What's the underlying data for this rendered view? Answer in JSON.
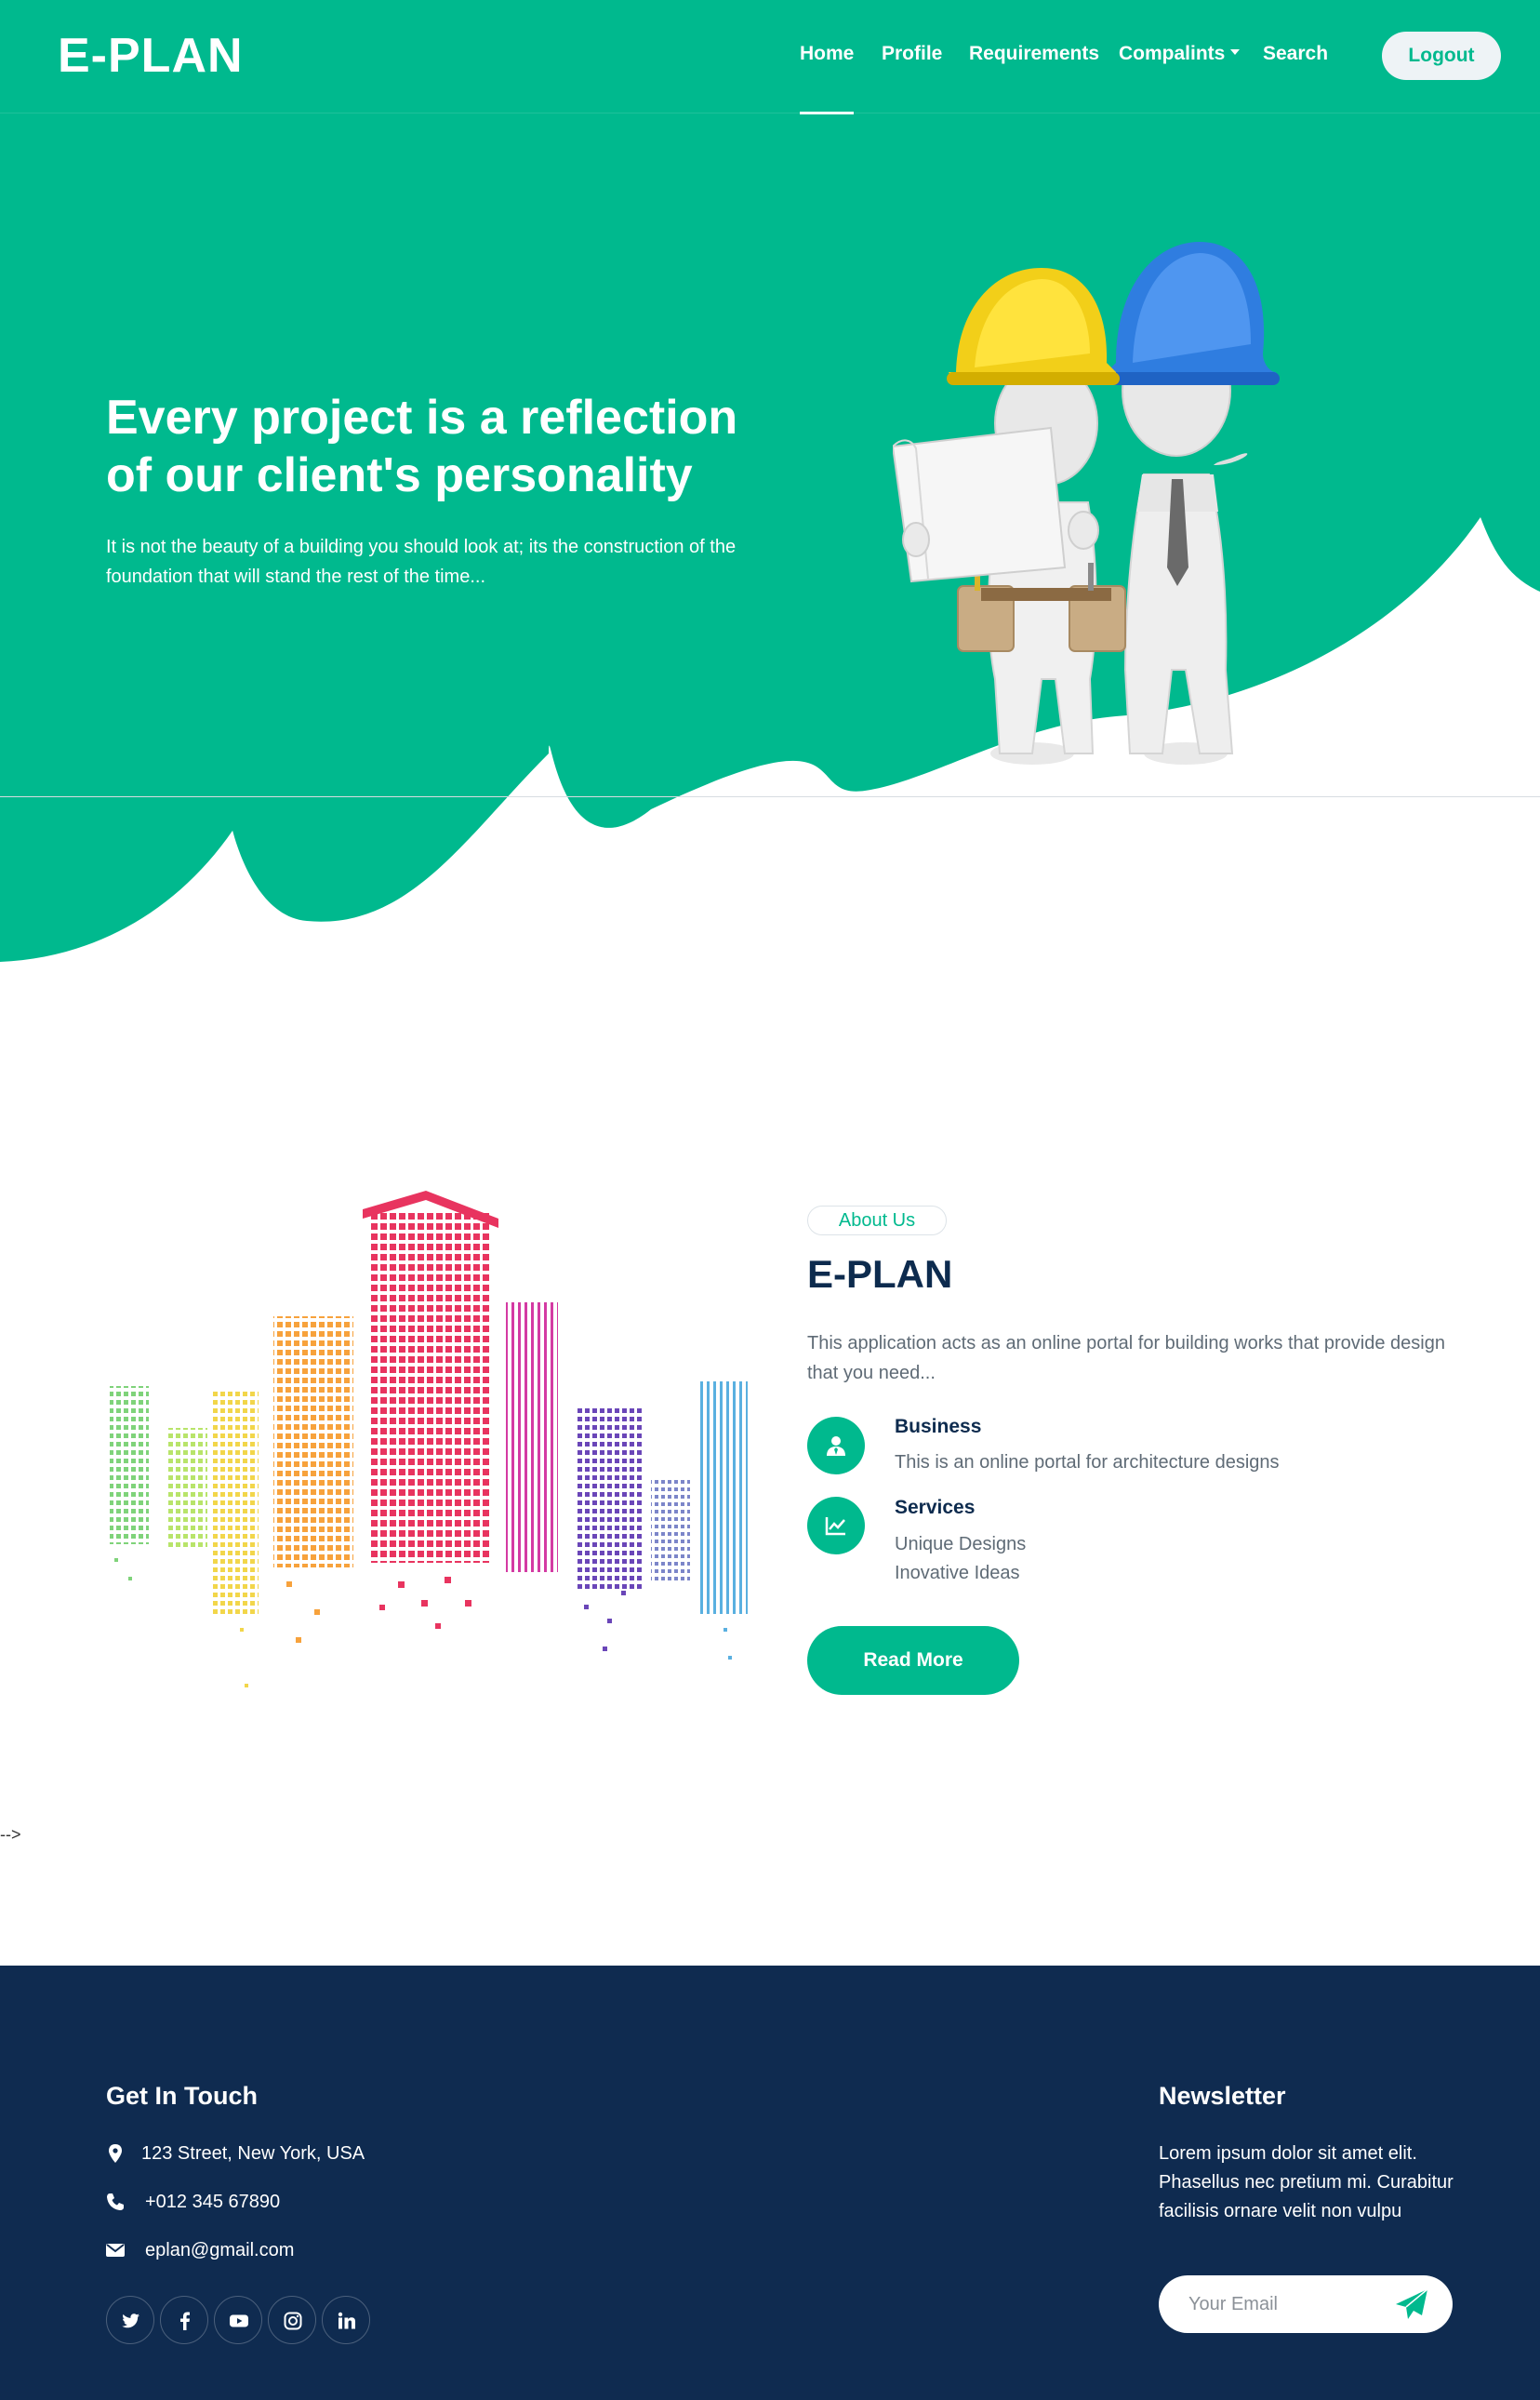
{
  "colors": {
    "primary": "#00b98e",
    "dark": "#0f2b50",
    "text_muted": "#5f6b76",
    "light_button": "#eef3f6"
  },
  "navbar": {
    "brand": "E-PLAN",
    "items": [
      {
        "label": "Home",
        "active": true
      },
      {
        "label": "Profile",
        "active": false
      },
      {
        "label": "Requirements",
        "active": false
      },
      {
        "label": "Compalints",
        "active": false,
        "dropdown": true
      },
      {
        "label": "Search",
        "active": false
      }
    ],
    "logout_label": "Logout"
  },
  "hero": {
    "title_line1": "Every project is a reflection",
    "title_line2": "of our client's personality",
    "text": "It is not the beauty of a building you should look at; its the construction of the foundation that will stand the rest of the time..."
  },
  "about": {
    "badge": "About Us",
    "title": "E-PLAN",
    "text": "This application acts as an online portal for building works that provide design that you need...",
    "features": [
      {
        "icon": "user-tie-icon",
        "title": "Business",
        "lines": [
          "This is an online portal for architecture designs"
        ]
      },
      {
        "icon": "chart-line-icon",
        "title": "Services",
        "lines": [
          "Unique Designs",
          "Inovative Ideas"
        ]
      }
    ],
    "read_more_label": "Read More"
  },
  "stray_text": "-->",
  "footer": {
    "contact": {
      "heading": "Get In Touch",
      "address": "123 Street, New York, USA",
      "phone": "+012 345 67890",
      "email": "eplan@gmail.com"
    },
    "social": [
      "twitter-icon",
      "facebook-icon",
      "youtube-icon",
      "instagram-icon",
      "linkedin-icon"
    ],
    "newsletter": {
      "heading": "Newsletter",
      "text": "Lorem ipsum dolor sit amet elit. Phasellus nec pretium mi. Curabitur facilisis ornare velit non vulpu",
      "placeholder": "Your Email"
    }
  }
}
